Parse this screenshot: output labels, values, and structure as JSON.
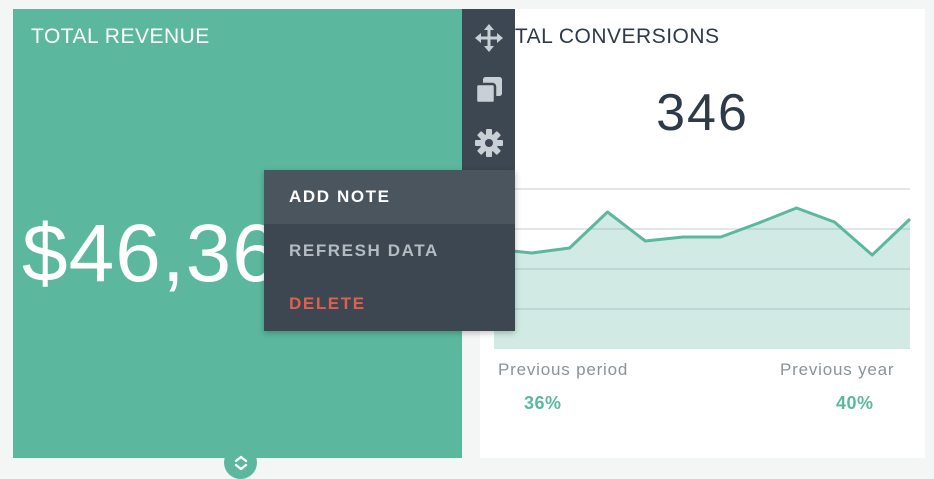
{
  "revenue_card": {
    "title": "TOTAL REVENUE",
    "value": "$46,36"
  },
  "conversions_card": {
    "title": "OTAL CONVERSIONS",
    "value": "346",
    "previous_period_label": "Previous period",
    "previous_period_value": "36%",
    "previous_year_label": "Previous year",
    "previous_year_value": "40%"
  },
  "toolbar": {
    "icons": [
      "move-icon",
      "duplicate-icon",
      "gear-icon"
    ]
  },
  "context_menu": {
    "add_note": "ADD NOTE",
    "refresh_data": "REFRESH DATA",
    "delete": "DELETE"
  },
  "colors": {
    "accent": "#5bb89e",
    "panel": "#3c4751",
    "danger": "#e0604c",
    "text_dark": "#2e3a49"
  },
  "chart_data": {
    "type": "area",
    "series": [
      {
        "values": [
          240,
          244,
          239,
          203,
          232,
          228,
          228,
          214,
          199,
          213,
          246,
          210
        ]
      }
    ]
  }
}
